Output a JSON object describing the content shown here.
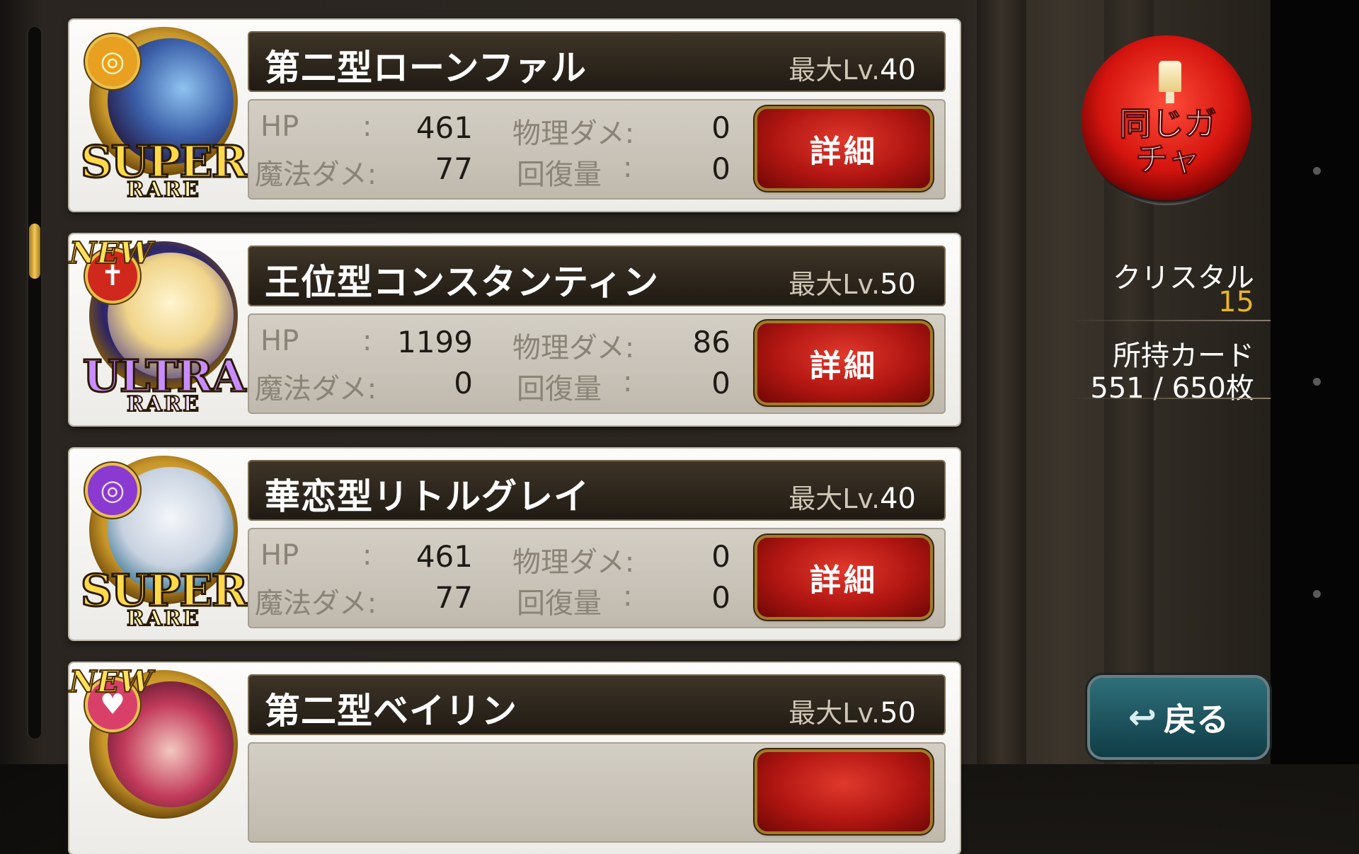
{
  "cards": [
    {
      "name": "第二型ローンファル",
      "max_lv_label": "最大Lv.",
      "max_lv": "40",
      "is_new": false,
      "rarity_main": "SUPER",
      "rarity_sub": "RARE",
      "element_symbol": "◎",
      "element_color": "#e8a020",
      "stats": {
        "hp_label": "HP",
        "hp_sep": ":",
        "hp": "461",
        "magic_label": "魔法ダメ:",
        "magic": "77",
        "phys_label": "物理ダメ:",
        "phys": "0",
        "heal_label": "回復量",
        "heal_sep": ":",
        "heal": "0"
      },
      "detail_label": "詳細"
    },
    {
      "name": "王位型コンスタンティン",
      "max_lv_label": "最大Lv.",
      "max_lv": "50",
      "is_new": true,
      "new_label": "NEW",
      "rarity_main": "ULTRA",
      "rarity_sub": "RARE",
      "element_symbol": "✝",
      "element_color": "#d0281c",
      "stats": {
        "hp_label": "HP",
        "hp_sep": ":",
        "hp": "1199",
        "magic_label": "魔法ダメ:",
        "magic": "0",
        "phys_label": "物理ダメ:",
        "phys": "86",
        "heal_label": "回復量",
        "heal_sep": ":",
        "heal": "0"
      },
      "detail_label": "詳細"
    },
    {
      "name": "華恋型リトルグレイ",
      "max_lv_label": "最大Lv.",
      "max_lv": "40",
      "is_new": false,
      "rarity_main": "SUPER",
      "rarity_sub": "RARE",
      "element_symbol": "◎",
      "element_color": "#8a3ad0",
      "stats": {
        "hp_label": "HP",
        "hp_sep": ":",
        "hp": "461",
        "magic_label": "魔法ダメ:",
        "magic": "77",
        "phys_label": "物理ダメ:",
        "phys": "0",
        "heal_label": "回復量",
        "heal_sep": ":",
        "heal": "0"
      },
      "detail_label": "詳細"
    },
    {
      "name": "第二型ベイリン",
      "max_lv_label": "最大Lv.",
      "max_lv": "50",
      "is_new": true,
      "new_label": "NEW",
      "element_symbol": "♥",
      "element_color": "#d8406a"
    }
  ],
  "side": {
    "gacha_label": "同じガチャ",
    "crystal_label": "クリスタル",
    "crystal_value": "15",
    "cards_label": "所持カード",
    "cards_value": "551 / 650枚",
    "back_label": "戻る",
    "back_icon": "return-arrow-icon"
  },
  "colors": {
    "detail_red": "#c41e16",
    "crystal_gold": "#e8b52a",
    "back_teal": "#1f5560"
  }
}
